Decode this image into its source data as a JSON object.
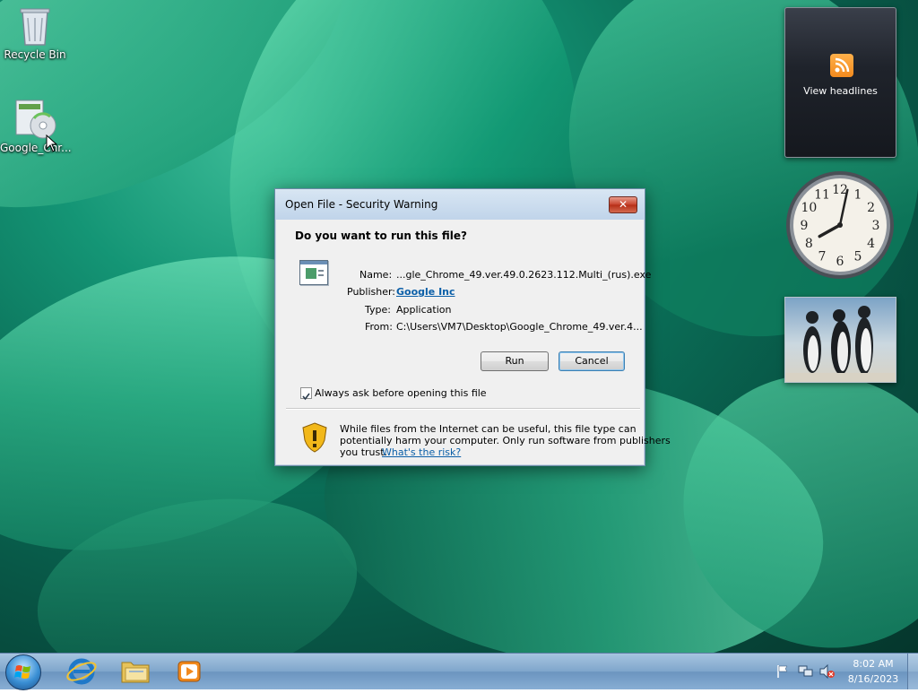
{
  "desktop": {
    "icons": [
      {
        "label": "Recycle Bin",
        "icon": "recycle-bin-icon"
      },
      {
        "label": "Google_Chr...",
        "icon": "installer-disc-icon"
      }
    ]
  },
  "gadgets": {
    "feed": {
      "label": "View headlines",
      "icon": "rss-icon",
      "accent": "#f28a1e"
    },
    "clock": {
      "numbers": [
        "12",
        "1",
        "2",
        "3",
        "4",
        "5",
        "6",
        "7",
        "8",
        "9",
        "10",
        "11"
      ],
      "hour": 8,
      "minute": 2
    },
    "slideshow": {
      "icon": "penguins-photo"
    }
  },
  "dialog": {
    "title": "Open File - Security Warning",
    "close_label": "✕",
    "question": "Do you want to run this file?",
    "fields": {
      "name_label": "Name:",
      "name_value": "...gle_Chrome_49.ver.49.0.2623.112.Multi_(rus).exe",
      "publisher_label": "Publisher:",
      "publisher_value": "Google Inc",
      "type_label": "Type:",
      "type_value": "Application",
      "from_label": "From:",
      "from_value": "C:\\Users\\VM7\\Desktop\\Google_Chrome_49.ver.4..."
    },
    "buttons": {
      "run": "Run",
      "cancel": "Cancel"
    },
    "checkbox": {
      "label": "Always ask before opening this file",
      "checked": true
    },
    "warning": {
      "line1": "While files from the Internet can be useful, this file type can",
      "line2": "potentially harm your computer. Only run software from publishers",
      "line3": "you trust.",
      "link": "What's the risk?"
    }
  },
  "taskbar": {
    "items": [
      "start-orb-icon",
      "internet-explorer-icon",
      "explorer-folder-icon",
      "media-player-icon"
    ],
    "tray": {
      "time": "8:02 AM",
      "date": "8/16/2023"
    }
  }
}
